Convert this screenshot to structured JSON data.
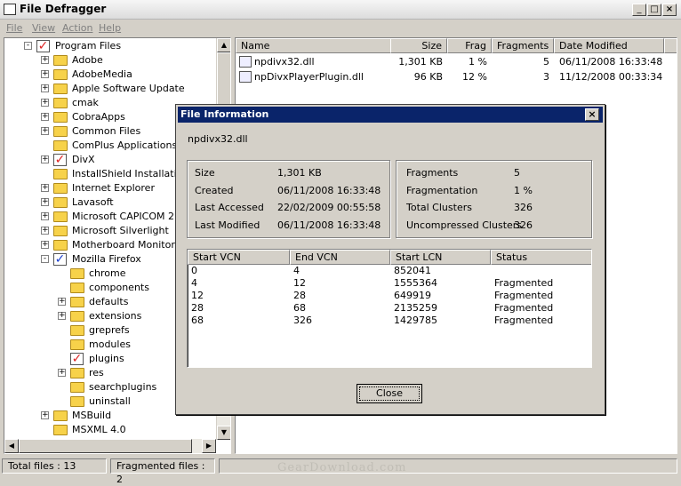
{
  "window": {
    "title": "File Defragger"
  },
  "menu": [
    "File",
    "View",
    "Action",
    "Help"
  ],
  "tree": [
    {
      "label": "Program Files",
      "indent": 0,
      "expander": "-",
      "icon": "checked-folder"
    },
    {
      "label": "Adobe",
      "indent": 1,
      "expander": "+",
      "icon": "folder"
    },
    {
      "label": "AdobeMedia",
      "indent": 1,
      "expander": "+",
      "icon": "folder"
    },
    {
      "label": "Apple Software Update",
      "indent": 1,
      "expander": "+",
      "icon": "folder"
    },
    {
      "label": "cmak",
      "indent": 1,
      "expander": "+",
      "icon": "folder"
    },
    {
      "label": "CobraApps",
      "indent": 1,
      "expander": "+",
      "icon": "folder"
    },
    {
      "label": "Common Files",
      "indent": 1,
      "expander": "+",
      "icon": "folder"
    },
    {
      "label": "ComPlus Applications",
      "indent": 1,
      "expander": "",
      "icon": "folder"
    },
    {
      "label": "DivX",
      "indent": 1,
      "expander": "+",
      "icon": "checked-folder"
    },
    {
      "label": "InstallShield Installation",
      "indent": 1,
      "expander": "",
      "icon": "folder"
    },
    {
      "label": "Internet Explorer",
      "indent": 1,
      "expander": "+",
      "icon": "folder"
    },
    {
      "label": "Lavasoft",
      "indent": 1,
      "expander": "+",
      "icon": "folder"
    },
    {
      "label": "Microsoft CAPICOM 2.1",
      "indent": 1,
      "expander": "+",
      "icon": "folder"
    },
    {
      "label": "Microsoft Silverlight",
      "indent": 1,
      "expander": "+",
      "icon": "folder"
    },
    {
      "label": "Motherboard Monitor 5",
      "indent": 1,
      "expander": "+",
      "icon": "folder"
    },
    {
      "label": "Mozilla Firefox",
      "indent": 1,
      "expander": "-",
      "icon": "blue-checked-folder"
    },
    {
      "label": "chrome",
      "indent": 2,
      "expander": "",
      "icon": "folder"
    },
    {
      "label": "components",
      "indent": 2,
      "expander": "",
      "icon": "folder"
    },
    {
      "label": "defaults",
      "indent": 2,
      "expander": "+",
      "icon": "folder"
    },
    {
      "label": "extensions",
      "indent": 2,
      "expander": "+",
      "icon": "folder"
    },
    {
      "label": "greprefs",
      "indent": 2,
      "expander": "",
      "icon": "folder"
    },
    {
      "label": "modules",
      "indent": 2,
      "expander": "",
      "icon": "folder"
    },
    {
      "label": "plugins",
      "indent": 2,
      "expander": "",
      "icon": "checked-folder"
    },
    {
      "label": "res",
      "indent": 2,
      "expander": "+",
      "icon": "folder"
    },
    {
      "label": "searchplugins",
      "indent": 2,
      "expander": "",
      "icon": "folder"
    },
    {
      "label": "uninstall",
      "indent": 2,
      "expander": "",
      "icon": "folder"
    },
    {
      "label": "MSBuild",
      "indent": 1,
      "expander": "+",
      "icon": "folder"
    },
    {
      "label": "MSXML 4.0",
      "indent": 1,
      "expander": "",
      "icon": "folder"
    }
  ],
  "list": {
    "columns": [
      "Name",
      "Size",
      "Frag",
      "Fragments",
      "Date Modified"
    ],
    "rows": [
      {
        "name": "npdivx32.dll",
        "size": "1,301 KB",
        "frag": "1 %",
        "fragments": "5",
        "date": "06/11/2008 16:33:48"
      },
      {
        "name": "npDivxPlayerPlugin.dll",
        "size": "96 KB",
        "frag": "12 %",
        "fragments": "3",
        "date": "11/12/2008 00:33:34"
      }
    ]
  },
  "dialog": {
    "title": "File Information",
    "filename": "npdivx32.dll",
    "left": [
      {
        "label": "Size",
        "value": "1,301 KB"
      },
      {
        "label": "Created",
        "value": "06/11/2008 16:33:48"
      },
      {
        "label": "Last Accessed",
        "value": "22/02/2009 00:55:58"
      },
      {
        "label": "Last Modified",
        "value": "06/11/2008 16:33:48"
      }
    ],
    "right": [
      {
        "label": "Fragments",
        "value": "5"
      },
      {
        "label": "Fragmentation",
        "value": "1 %"
      },
      {
        "label": "Total Clusters",
        "value": "326"
      },
      {
        "label": "Uncompressed Clusters",
        "value": "326"
      }
    ],
    "vcn_columns": [
      "Start VCN",
      "End VCN",
      "Start LCN",
      "Status"
    ],
    "vcn_rows": [
      [
        "0",
        "4",
        "852041",
        ""
      ],
      [
        "4",
        "12",
        "1555364",
        "Fragmented"
      ],
      [
        "12",
        "28",
        "649919",
        "Fragmented"
      ],
      [
        "28",
        "68",
        "2135259",
        "Fragmented"
      ],
      [
        "68",
        "326",
        "1429785",
        "Fragmented"
      ]
    ],
    "close_label": "Close"
  },
  "status": {
    "total": "Total files : 13",
    "fragmented": "Fragmented files : 2"
  },
  "watermark": "GearDownload.com"
}
